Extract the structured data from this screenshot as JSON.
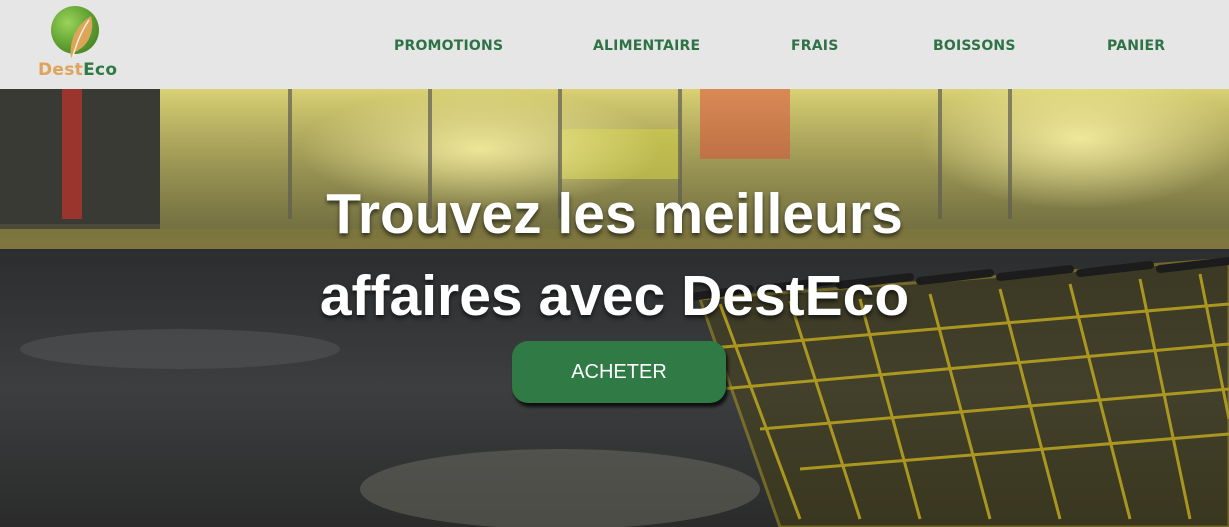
{
  "brand": {
    "name_part1": "Dest",
    "name_part2": "Eco"
  },
  "nav": {
    "items": [
      {
        "label": "PROMOTIONS"
      },
      {
        "label": "ALIMENTAIRE"
      },
      {
        "label": "FRAIS"
      },
      {
        "label": "BOISSONS"
      },
      {
        "label": "PANIER"
      }
    ]
  },
  "hero": {
    "title_line1": "Trouvez les meilleurs",
    "title_line2": "affaires avec DestEco",
    "cta_label": "ACHETER"
  },
  "colors": {
    "brand_green": "#2f7a45",
    "logo_orange": "#e0a35a",
    "header_bg": "#e6e6e6"
  },
  "icons": {
    "logo": "leaf-globe-icon"
  }
}
